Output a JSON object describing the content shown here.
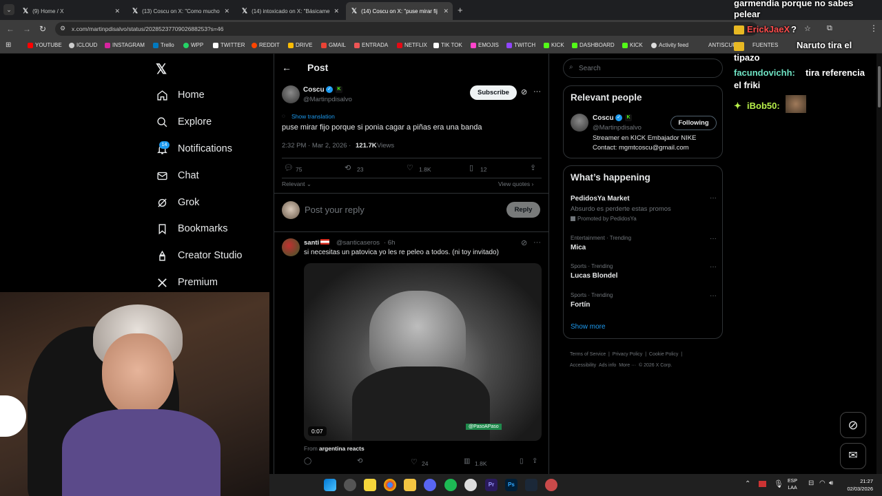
{
  "browser": {
    "tabs": [
      {
        "label": "(9) Home / X"
      },
      {
        "label": "(13) Coscu on X: \"Como mucho"
      },
      {
        "label": "(14) intoxicado on X: \"Básicame"
      },
      {
        "label": "(14) Coscu on X: \"puse mirar fij"
      }
    ],
    "url": "x.com/martinpdisalvo/status/2028523770902688253?s=46",
    "bookmarks": [
      "YOUTUBE",
      "ICLOUD",
      "INSTAGRAM",
      "Trello",
      "WPP",
      "TWITTER",
      "REDDIT",
      "DRIVE",
      "GMAIL",
      "ENTRADA",
      "NETFLIX",
      "TIK TOK",
      "EMOJIS",
      "TWITCH",
      "KICK",
      "DASHBOARD",
      "KICK",
      "Activity feed",
      "ANTISCUFF",
      "FUENTES"
    ]
  },
  "nav": {
    "items": [
      {
        "label": "Home",
        "icon": "home-icon"
      },
      {
        "label": "Explore",
        "icon": "search-icon"
      },
      {
        "label": "Notifications",
        "icon": "bell-icon",
        "badge": "14"
      },
      {
        "label": "Chat",
        "icon": "mail-icon"
      },
      {
        "label": "Grok",
        "icon": "grok-icon"
      },
      {
        "label": "Bookmarks",
        "icon": "bookmark-icon"
      },
      {
        "label": "Creator Studio",
        "icon": "creator-icon"
      },
      {
        "label": "Premium",
        "icon": "x-icon"
      }
    ]
  },
  "post": {
    "header": "Post",
    "author_name": "Coscu",
    "author_handle": "@Martinpdisalvo",
    "subscribe_label": "Subscribe",
    "show_translation": "Show translation",
    "text": "puse mirar fijo porque si ponia cagar a piñas era una banda",
    "timestamp": "2:32 PM · Mar 2, 2026 ·",
    "views": "121.7K",
    "views_label": "Views",
    "replies": "75",
    "reposts": "23",
    "likes": "1.8K",
    "bookmarks": "12",
    "sort_label": "Relevant",
    "view_quotes": "View quotes",
    "reply_placeholder": "Post your reply",
    "reply_button": "Reply"
  },
  "reply_tweet": {
    "name": "santi",
    "handle": "@santicaseros",
    "time": "· 6h",
    "text": "si necesitas un patovica yo les re peleo a todos. (ni toy invitado)",
    "video_time": "0:07",
    "video_watermark": "@PasoAPaso",
    "from_prefix": "From",
    "from_source": "argentina reacts",
    "likes": "24",
    "views": "1.8K"
  },
  "right": {
    "search_placeholder": "Search",
    "relevant_title": "Relevant people",
    "person_name": "Coscu",
    "person_handle": "@Martinpdisalvo",
    "following_label": "Following",
    "bio_line1": "Streamer en KICK Embajador NIKE",
    "bio_line2": "Contact: mgmtcoscu@gmail.com",
    "happening_title": "What’s happening",
    "trends": [
      {
        "category": "",
        "name": "PedidosYa Market",
        "sub": "Absurdo es perderte estas promos",
        "promo": "Promoted by PedidosYa"
      },
      {
        "category": "Entertainment · Trending",
        "name": "Mica"
      },
      {
        "category": "Sports · Trending",
        "name": "Lucas Blondel"
      },
      {
        "category": "Sports · Trending",
        "name": "Fortín"
      }
    ],
    "show_more": "Show more",
    "footer": [
      "Terms of Service",
      "|",
      "Privacy Policy",
      "|",
      "Cookie Policy",
      "|",
      "Accessibility",
      "Ads info",
      "More ···",
      "© 2026 X Corp."
    ]
  },
  "chat": {
    "lines": [
      {
        "user": "",
        "text": "garmendia porque no sabes"
      },
      {
        "user": "",
        "text": "pelear"
      },
      {
        "user": "ErickJaeX",
        "text": "?"
      },
      {
        "user": "",
        "text": "Naruto tira el"
      },
      {
        "user": "",
        "text": "tipazo"
      },
      {
        "user": "facundovichh:",
        "text": "tira referencia"
      },
      {
        "user": "",
        "text": "el friki"
      },
      {
        "user": "iBob50:",
        "text": ""
      }
    ],
    "colors": {
      "gold": "#e8b923",
      "red": "#ff4d4d",
      "teal": "#6fe3c4",
      "green": "#b8f04a"
    }
  },
  "taskbar": {
    "lang": "ESP",
    "lang2": "LAA",
    "time": "21:27",
    "date": "02/03/2026",
    "colors": {
      "accent": "#0078d4"
    }
  },
  "colors": {
    "x_blue": "#1d9bf0",
    "kick_green": "#53fc18",
    "bg": "#000000",
    "border": "#2f3336"
  }
}
